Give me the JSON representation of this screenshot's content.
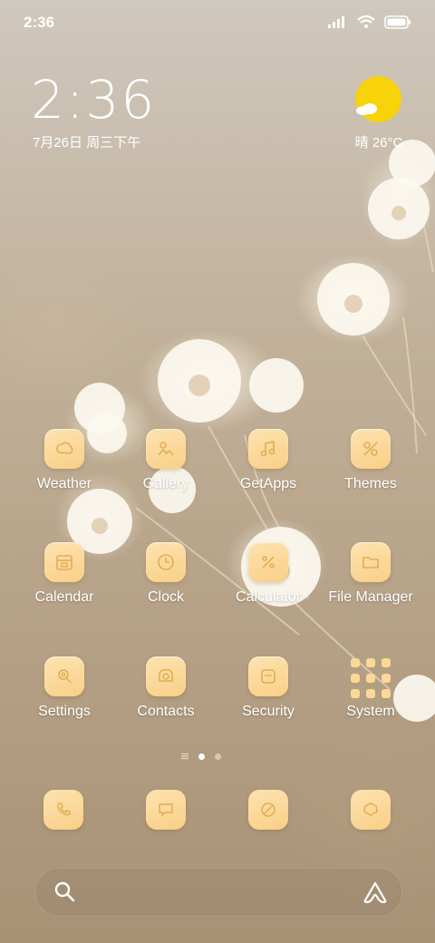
{
  "status_bar": {
    "time": "2:36",
    "icons": [
      "signal-icon",
      "wifi-icon",
      "battery-icon"
    ]
  },
  "clock_widget": {
    "time": "2:36",
    "date": "7月26日 周三下午"
  },
  "weather_widget": {
    "condition_icon": "sun-cloud-icon",
    "text": "晴 26°C"
  },
  "apps": [
    {
      "label": "Weather",
      "icon": "weather-icon"
    },
    {
      "label": "Gallery",
      "icon": "gallery-icon"
    },
    {
      "label": "GetApps",
      "icon": "getapps-icon"
    },
    {
      "label": "Themes",
      "icon": "themes-icon"
    },
    {
      "label": "Calendar",
      "icon": "calendar-icon"
    },
    {
      "label": "Clock",
      "icon": "clock-icon"
    },
    {
      "label": "Calculator",
      "icon": "calculator-icon"
    },
    {
      "label": "File Manager",
      "icon": "folder-icon"
    },
    {
      "label": "Settings",
      "icon": "settings-icon"
    },
    {
      "label": "Contacts",
      "icon": "contacts-icon"
    },
    {
      "label": "Security",
      "icon": "security-icon"
    },
    {
      "label": "System",
      "icon": "folder-grid-icon"
    }
  ],
  "pager": {
    "pages": 3,
    "current": 2
  },
  "dock": [
    {
      "icon": "phone-icon"
    },
    {
      "icon": "message-icon"
    },
    {
      "icon": "browser-icon"
    },
    {
      "icon": "camera-icon"
    }
  ],
  "search_bar": {
    "icon": "search-icon",
    "assistant_icon": "assistant-icon"
  },
  "colors": {
    "icon_bg": "#fbd897",
    "icon_line": "#e6b45a",
    "sun": "#f8d20b"
  }
}
